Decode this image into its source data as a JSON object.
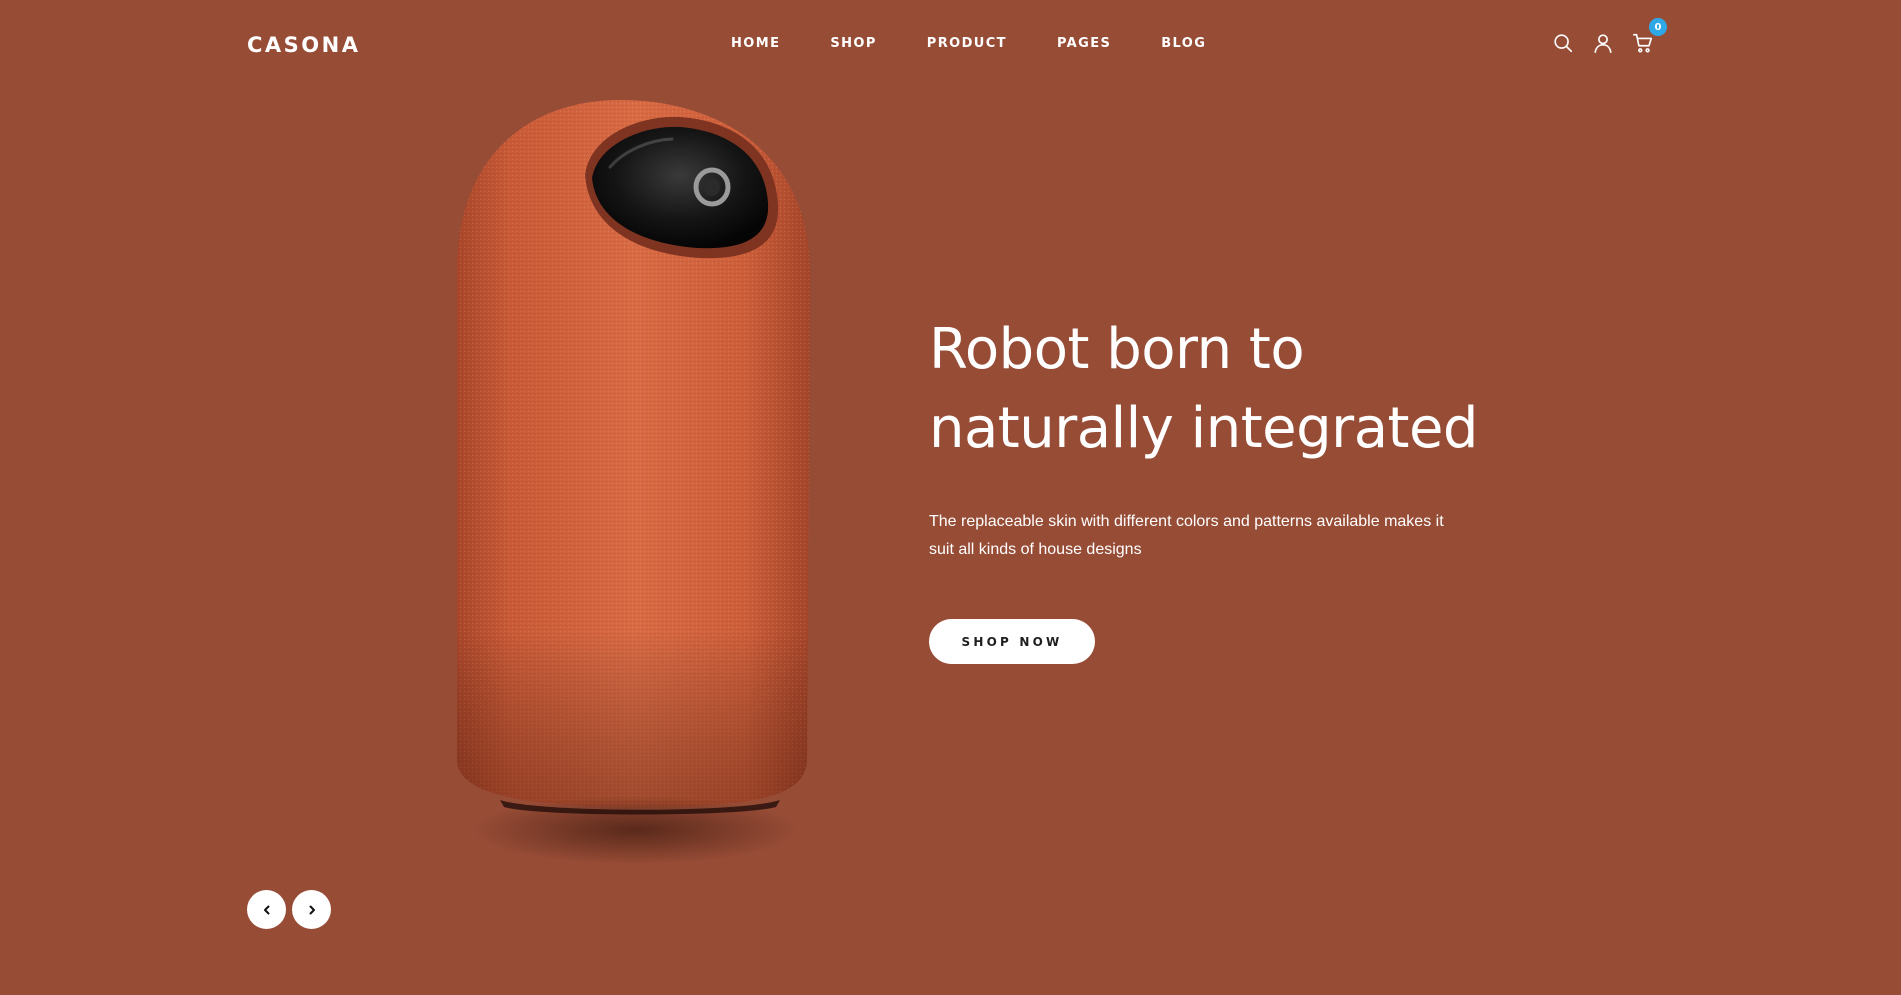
{
  "brand": {
    "logo": "CASONA"
  },
  "nav": {
    "items": [
      {
        "label": "HOME"
      },
      {
        "label": "SHOP"
      },
      {
        "label": "PRODUCT"
      },
      {
        "label": "PAGES"
      },
      {
        "label": "BLOG"
      }
    ]
  },
  "header": {
    "icons": [
      "search-icon",
      "user-icon",
      "cart-icon"
    ],
    "cart_count": "0"
  },
  "hero": {
    "title_line1": "Robot born to",
    "title_line2": "naturally integrated",
    "description_line1": "The replaceable skin with different colors and patterns available makes it",
    "description_line2": "suit all kinds of house designs",
    "cta_label": "SHOP NOW"
  },
  "slider": {
    "prev_icon": "chevron-left-icon",
    "next_icon": "chevron-right-icon"
  },
  "colors": {
    "background": "#974c36",
    "product_fabric": "#c8603e",
    "badge": "#2ea8e6",
    "text": "#ffffff",
    "button_bg": "#ffffff",
    "button_text": "#1f1f1f"
  }
}
